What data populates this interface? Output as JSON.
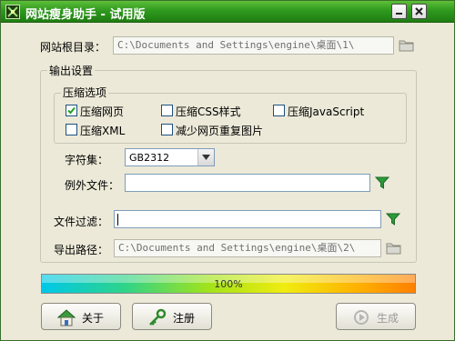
{
  "window": {
    "title": "网站瘦身助手 - 试用版",
    "icons": {
      "app": "app-logo-icon",
      "minimize": "minimize-icon",
      "close": "close-icon"
    }
  },
  "site_root": {
    "label": "网站根目录：",
    "value": "C:\\Documents and Settings\\engine\\桌面\\1\\",
    "browse_icon": "folder-icon"
  },
  "output_settings": {
    "legend": "输出设置",
    "compression": {
      "legend": "压缩选项",
      "options": [
        {
          "label": "压缩网页",
          "checked": true
        },
        {
          "label": "压缩CSS样式",
          "checked": false
        },
        {
          "label": "压缩JavaScript",
          "checked": false
        },
        {
          "label": "压缩XML",
          "checked": false
        },
        {
          "label": "减少网页重复图片",
          "checked": false
        }
      ]
    },
    "charset": {
      "label": "字符集：",
      "selected": "GB2312"
    },
    "exclude_files": {
      "label": "例外文件：",
      "value": "",
      "filter_icon": "filter-funnel-icon"
    },
    "file_filter": {
      "label": "文件过滤：",
      "value": "",
      "filter_icon": "filter-funnel-icon"
    },
    "export_path": {
      "label": "导出路径：",
      "value": "C:\\Documents and Settings\\engine\\桌面\\2\\",
      "browse_icon": "folder-icon"
    }
  },
  "progress": {
    "value": 1.0,
    "text": "100%"
  },
  "buttons": {
    "about": {
      "label": "关于",
      "icon": "home-icon"
    },
    "register": {
      "label": "注册",
      "icon": "key-icon"
    },
    "generate": {
      "label": "生成",
      "icon": "generate-icon",
      "enabled": false
    }
  },
  "colors": {
    "titlebar": "#2f9a1e",
    "window_bg": "#ece9d8",
    "filter_icon": "#2c9a3a"
  }
}
